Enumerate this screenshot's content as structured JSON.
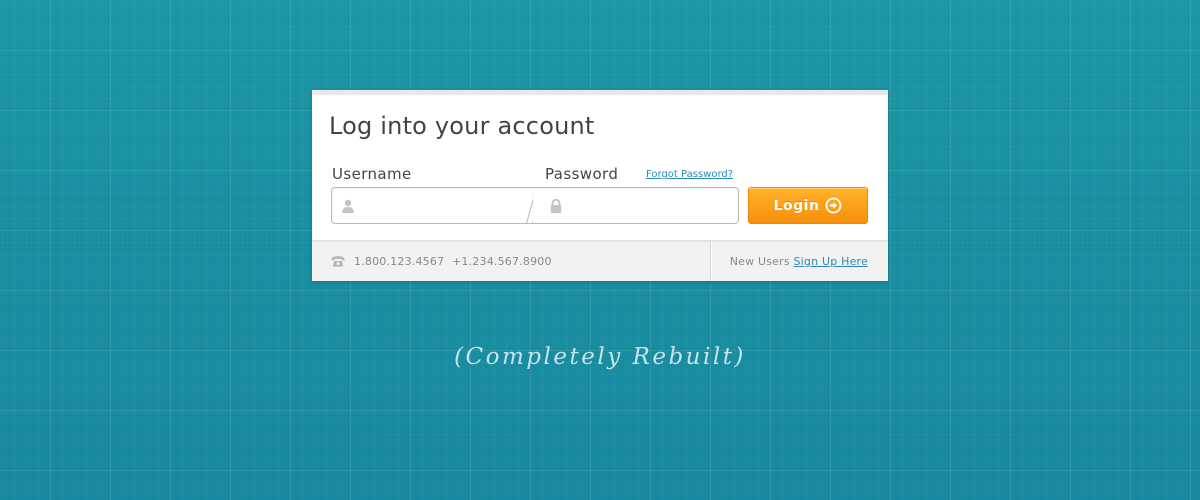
{
  "login": {
    "title": "Log into your account",
    "username_label": "Username",
    "password_label": "Password",
    "forgot_link": "Forgot Password?",
    "username_value": "",
    "password_value": "",
    "button_label": "Login"
  },
  "footer": {
    "phone_1": "1.800.123.4567",
    "phone_2": "+1.234.567.8900",
    "new_users_text": "New Users",
    "signup_link": "Sign Up Here"
  },
  "caption": "(Completely Rebuilt)",
  "icons": {
    "username": "user-icon",
    "password": "lock-icon",
    "button": "arrow-right-circle-icon",
    "phone": "phone-icon"
  },
  "colors": {
    "background": "#1a8fa0",
    "button": "#fb9e18",
    "link": "#2a8ab5"
  }
}
